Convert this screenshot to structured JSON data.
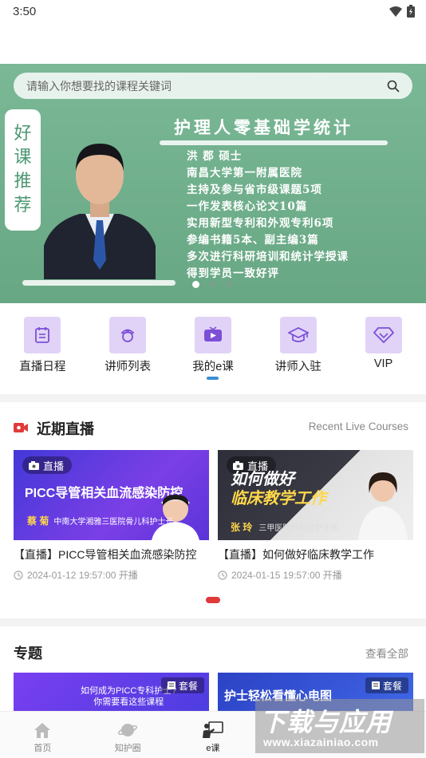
{
  "status": {
    "time": "3:50"
  },
  "search": {
    "placeholder": "请输入你想要找的课程关键词"
  },
  "banner": {
    "tag_chars": [
      "好",
      "课",
      "推",
      "荐"
    ],
    "title": "护理人零基础学统计",
    "bio": [
      "洪 郡  硕士",
      "南昌大学第一附属医院",
      "主持及参与省市级课题5项",
      "一作发表核心论文10篇",
      "实用新型专利和外观专利6项",
      "参编书籍5本、副主编3篇",
      "多次进行科研培训和统计学授课",
      "得到学员一致好评"
    ],
    "active_dot": 1
  },
  "quick_nav": [
    {
      "label": "直播日程",
      "icon": "calendar-icon"
    },
    {
      "label": "讲师列表",
      "icon": "nurse-icon"
    },
    {
      "label": "我的e课",
      "icon": "video-play-icon"
    },
    {
      "label": "讲师入驻",
      "icon": "graduation-cap-icon"
    },
    {
      "label": "VIP",
      "icon": "diamond-icon"
    }
  ],
  "live": {
    "title": "近期直播",
    "subtitle": "Recent Live Courses",
    "badge": "直播",
    "items": [
      {
        "thumb_title": "PICC导管相关血流感染防控",
        "thumb_name": "蔡 菊",
        "thumb_sub": "中南大学湘雅三医院骨儿科护士长",
        "title": "【直播】PICC导管相关血流感染防控",
        "time": "2024-01-12 19:57:00 开播"
      },
      {
        "thumb_title_1": "如何做好",
        "thumb_title_2": "临床教学工作",
        "thumb_name": "张 玲",
        "thumb_sub": "三甲医院外科总护士长",
        "title": "【直播】如何做好临床教学工作",
        "time": "2024-01-15 19:57:00 开播"
      }
    ]
  },
  "topics": {
    "title": "专题",
    "more": "查看全部",
    "items": [
      {
        "badge": "套餐",
        "text_1": "如何成为PICC专科护士?",
        "text_2": "你需要看这些课程"
      },
      {
        "badge": "套餐",
        "text": "护士轻松看懂心电图"
      }
    ]
  },
  "tabs": [
    {
      "label": "首页",
      "icon": "home-icon"
    },
    {
      "label": "知护圈",
      "icon": "planet-icon"
    },
    {
      "label": "e课",
      "icon": "e-course-icon",
      "active": true
    },
    {
      "label": "",
      "icon": ""
    },
    {
      "label": "",
      "icon": ""
    }
  ],
  "watermark": {
    "big": "下载与应用",
    "small": "www.xiazainiao.com"
  },
  "colors": {
    "banner": "#6fae8c",
    "accent": "#3a8ed6",
    "live_red": "#e03a3a",
    "nav_icon_bg": "#e1d3f7"
  }
}
